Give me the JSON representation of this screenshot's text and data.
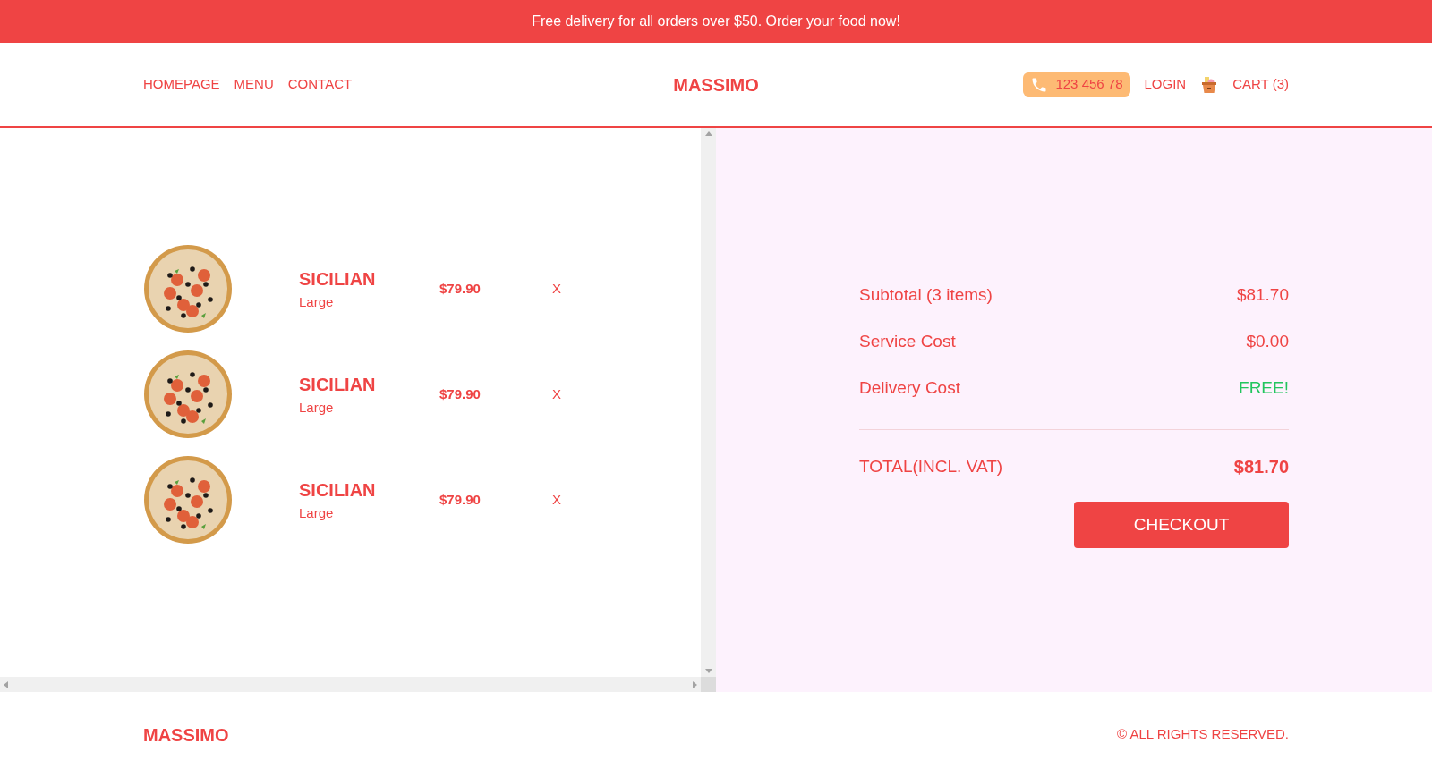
{
  "banner": {
    "text": "Free delivery for all orders over $50. Order your food now!"
  },
  "nav": {
    "links": [
      "HOMEPAGE",
      "MENU",
      "CONTACT"
    ],
    "logo": "MASSIMO",
    "phone": "123 456 78",
    "login": "LOGIN",
    "cart": "CART (3)"
  },
  "cart_items": [
    {
      "name": "SICILIAN",
      "size": "Large",
      "price": "$79.90",
      "remove": "X"
    },
    {
      "name": "SICILIAN",
      "size": "Large",
      "price": "$79.90",
      "remove": "X"
    },
    {
      "name": "SICILIAN",
      "size": "Large",
      "price": "$79.90",
      "remove": "X"
    }
  ],
  "summary": {
    "rows": [
      {
        "label": "Subtotal (3 items)",
        "value": "$81.70",
        "kind": "normal"
      },
      {
        "label": "Service Cost",
        "value": "$0.00",
        "kind": "normal"
      },
      {
        "label": "Delivery Cost",
        "value": "FREE!",
        "kind": "free"
      }
    ],
    "total": {
      "label": "TOTAL(INCL. VAT)",
      "value": "$81.70"
    },
    "checkout": "CHECKOUT"
  },
  "footer": {
    "logo": "MASSIMO",
    "copyright": "© ALL RIGHTS RESERVED."
  }
}
